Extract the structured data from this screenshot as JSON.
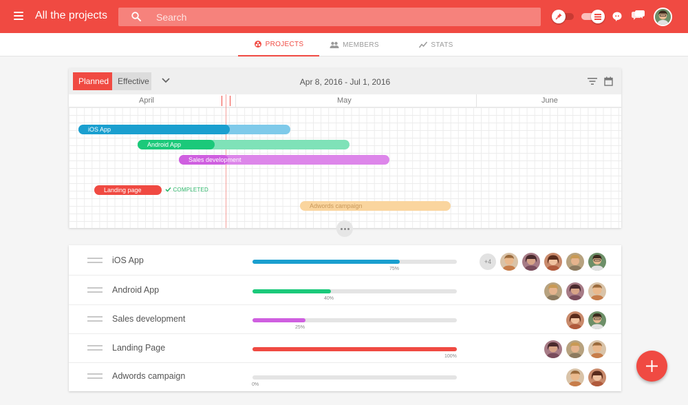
{
  "colors": {
    "accent": "#f04a42",
    "ios": "#1a9fcf",
    "ios_light": "#7fcaea",
    "android": "#1bc97a",
    "android_light": "#7fe2b8",
    "sales": "#cf5fe0",
    "sales_light": "#dd86ea",
    "landing": "#f04a42",
    "adwords_light": "#fad59e",
    "completed": "#2fb86b"
  },
  "header": {
    "title": "All the projects",
    "search_placeholder": "Search",
    "icons": [
      "menu-icon",
      "search-icon",
      "pin-icon",
      "view-toggle",
      "chat-icon",
      "notifications-icon"
    ]
  },
  "tabs": [
    {
      "label": "PROJECTS",
      "icon": "projects-icon",
      "active": true
    },
    {
      "label": "MEMBERS",
      "icon": "members-icon",
      "active": false
    },
    {
      "label": "STATS",
      "icon": "stats-icon",
      "active": false
    }
  ],
  "gantt": {
    "mode_planned": "Planned",
    "mode_effective": "Effective",
    "date_range": "Apr 8, 2016 - Jul 1, 2016",
    "months": [
      "April",
      "May",
      "June"
    ],
    "bars": [
      {
        "label": "iOS App",
        "progress": 0.75
      },
      {
        "label": "Android App",
        "progress": 0.4
      },
      {
        "label": "Sales development",
        "progress": 0.25
      },
      {
        "label": "Landing page",
        "progress": 1.0
      },
      {
        "label": "Adwords campaign",
        "progress": 0
      }
    ],
    "completed_label": "COMPLETED"
  },
  "projects": [
    {
      "name": "iOS App",
      "progress": 75,
      "progress_label": "75%",
      "extra_members": "+4"
    },
    {
      "name": "Android App",
      "progress": 40,
      "progress_label": "40%"
    },
    {
      "name": "Sales development",
      "progress": 25,
      "progress_label": "25%"
    },
    {
      "name": "Landing Page",
      "progress": 100,
      "progress_label": "100%"
    },
    {
      "name": "Adwords campaign",
      "progress": 0,
      "progress_label": "0%"
    }
  ]
}
